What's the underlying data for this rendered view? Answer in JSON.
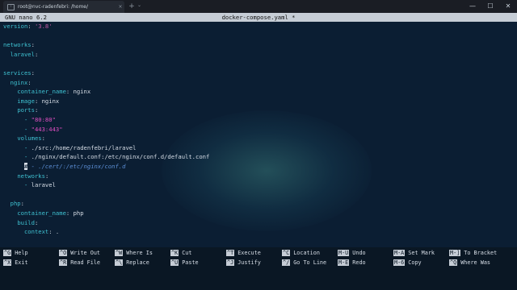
{
  "window": {
    "tab_title": "root@nvc-radenfebri: /home/",
    "tab_close": "×",
    "new_tab": "+",
    "dropdown": "⌄",
    "minimize": "—",
    "maximize": "☐",
    "close": "✕"
  },
  "nano": {
    "version": "GNU nano 6.2",
    "filename": "docker-compose.yaml *"
  },
  "editor": {
    "l01": {
      "key": "version",
      "sep": ": ",
      "val": "'3.8'"
    },
    "l03": {
      "key": "networks",
      "sep": ":"
    },
    "l04": {
      "key": "laravel",
      "sep": ":"
    },
    "l06": {
      "key": "services",
      "sep": ":"
    },
    "l07": {
      "key": "nginx",
      "sep": ":"
    },
    "l08": {
      "key": "container_name",
      "sep": ": ",
      "val": "nginx"
    },
    "l09": {
      "key": "image",
      "sep": ": ",
      "val": "nginx"
    },
    "l10": {
      "key": "ports",
      "sep": ":"
    },
    "l11": {
      "dash": "- ",
      "val": "\"80:80\""
    },
    "l12": {
      "dash": "- ",
      "val": "\"443:443\""
    },
    "l13": {
      "key": "volumes",
      "sep": ":"
    },
    "l14": {
      "dash": "- ",
      "val": "./src:/home/radenfebri/laravel"
    },
    "l15": {
      "dash": "- ",
      "val": "./nginx/default.conf:/etc/nginx/conf.d/default.conf"
    },
    "l16": {
      "cursor": "#",
      "val": "- ./cert/:/etc/nginx/conf.d"
    },
    "l17": {
      "key": "networks",
      "sep": ":"
    },
    "l18": {
      "dash": "- ",
      "val": "laravel"
    },
    "l20": {
      "key": "php",
      "sep": ":"
    },
    "l21": {
      "key": "container_name",
      "sep": ": ",
      "val": "php"
    },
    "l22": {
      "key": "build",
      "sep": ":"
    },
    "l23": {
      "key": "context",
      "sep": ": ",
      "val": "."
    }
  },
  "shortcuts": [
    {
      "key": "^G",
      "label": "Help"
    },
    {
      "key": "^O",
      "label": "Write Out"
    },
    {
      "key": "^W",
      "label": "Where Is"
    },
    {
      "key": "^K",
      "label": "Cut"
    },
    {
      "key": "^T",
      "label": "Execute"
    },
    {
      "key": "^C",
      "label": "Location"
    },
    {
      "key": "M-U",
      "label": "Undo"
    },
    {
      "key": "M-A",
      "label": "Set Mark"
    },
    {
      "key": "M-]",
      "label": "To Bracket"
    },
    {
      "key": "^X",
      "label": "Exit"
    },
    {
      "key": "^R",
      "label": "Read File"
    },
    {
      "key": "^\\",
      "label": "Replace"
    },
    {
      "key": "^U",
      "label": "Paste"
    },
    {
      "key": "^J",
      "label": "Justify"
    },
    {
      "key": "^/",
      "label": "Go To Line"
    },
    {
      "key": "M-E",
      "label": "Redo"
    },
    {
      "key": "M-6",
      "label": "Copy"
    },
    {
      "key": "^Q",
      "label": "Where Was"
    }
  ],
  "colors": {
    "background": "#0b1e33",
    "yaml_key": "#3fc1d1",
    "yaml_string": "#e04fc2",
    "comment": "#5c8fd6",
    "header_bar": "#c6cdd6"
  }
}
